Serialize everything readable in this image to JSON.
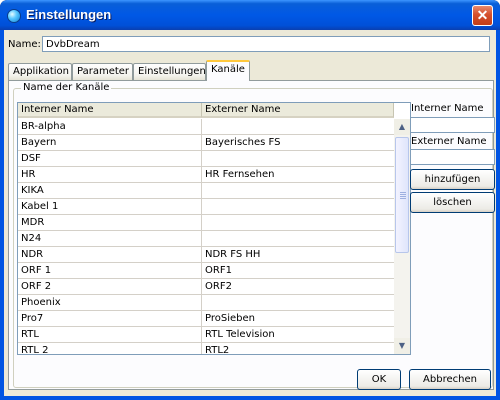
{
  "window": {
    "title": "Einstellungen",
    "close_glyph": "✕"
  },
  "name_field": {
    "label": "Name:",
    "value": "DvbDream"
  },
  "tabs": [
    {
      "label": "Applikation",
      "active": false
    },
    {
      "label": "Parameter",
      "active": false
    },
    {
      "label": "Einstellungen",
      "active": false
    },
    {
      "label": "Kanäle",
      "active": true
    }
  ],
  "group": {
    "title": "Name der Kanäle"
  },
  "table": {
    "columns": [
      "Interner Name",
      "Externer Name"
    ],
    "rows": [
      {
        "internal": "BR-alpha",
        "external": ""
      },
      {
        "internal": "Bayern",
        "external": "Bayerisches FS"
      },
      {
        "internal": "DSF",
        "external": ""
      },
      {
        "internal": "HR",
        "external": "HR Fernsehen"
      },
      {
        "internal": "KIKA",
        "external": ""
      },
      {
        "internal": "Kabel 1",
        "external": ""
      },
      {
        "internal": "MDR",
        "external": ""
      },
      {
        "internal": "N24",
        "external": ""
      },
      {
        "internal": "NDR",
        "external": "NDR FS HH"
      },
      {
        "internal": "ORF 1",
        "external": "ORF1"
      },
      {
        "internal": "ORF 2",
        "external": "ORF2"
      },
      {
        "internal": "Phoenix",
        "external": ""
      },
      {
        "internal": "Pro7",
        "external": "ProSieben"
      },
      {
        "internal": "RTL",
        "external": "RTL Television"
      },
      {
        "internal": "RTL 2",
        "external": "RTL2"
      }
    ]
  },
  "side_panel": {
    "internal_label": "Interner Name",
    "internal_value": "",
    "external_label": "Externer Name",
    "external_value": "",
    "add_button": "hinzufügen",
    "delete_button": "löschen"
  },
  "footer": {
    "ok_button": "OK",
    "cancel_button": "Abbrechen"
  },
  "colors": {
    "titlebar": "#0058e6",
    "active_tab_highlight": "#ffc83c",
    "dialog_background": "#ece9d8"
  }
}
